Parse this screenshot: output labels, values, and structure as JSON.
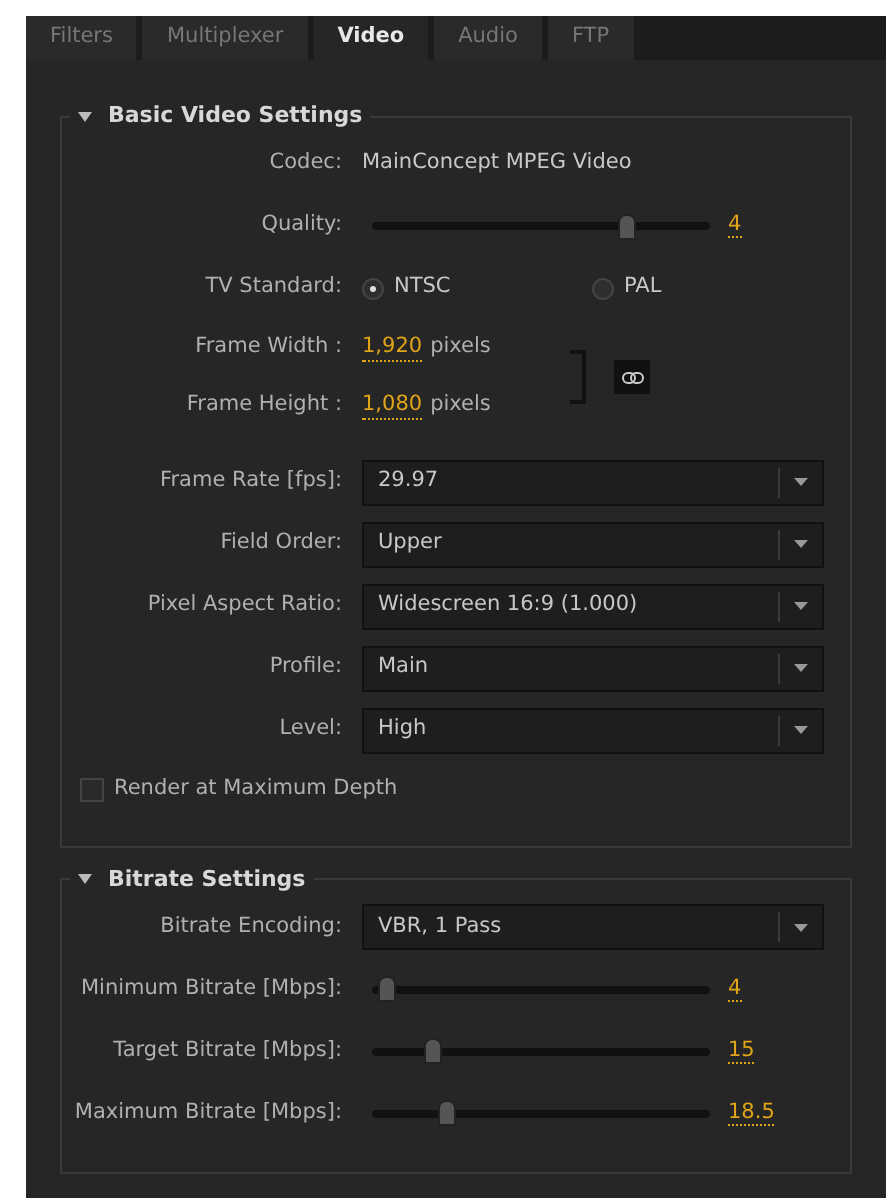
{
  "tabs": [
    {
      "label": "Filters",
      "selected": false
    },
    {
      "label": "Multiplexer",
      "selected": false
    },
    {
      "label": "Video",
      "selected": true
    },
    {
      "label": "Audio",
      "selected": false
    },
    {
      "label": "FTP",
      "selected": false
    }
  ],
  "sections": [
    {
      "title": "Basic Video Settings",
      "expanded": true,
      "rows": [
        {
          "kind": "text",
          "label": "Codec:",
          "value": "MainConcept MPEG Video"
        },
        {
          "kind": "slider",
          "label": "Quality:",
          "level": 0.75,
          "value": "4"
        },
        {
          "kind": "radio",
          "label": "TV Standard:",
          "options": [
            {
              "label": "NTSC",
              "selected": true
            },
            {
              "label": "PAL",
              "selected": false
            }
          ]
        },
        {
          "kind": "dimensions",
          "linked": true,
          "fields": [
            {
              "label": "Frame Width :",
              "value": "1,920",
              "unit": "pixels"
            },
            {
              "label": "Frame Height :",
              "value": "1,080",
              "unit": "pixels"
            }
          ]
        },
        {
          "kind": "dropdown",
          "label": "Frame Rate [fps]:",
          "value": "29.97"
        },
        {
          "kind": "dropdown",
          "label": "Field Order:",
          "value": "Upper"
        },
        {
          "kind": "dropdown",
          "label": "Pixel Aspect Ratio:",
          "value": "Widescreen 16:9 (1.000)"
        },
        {
          "kind": "dropdown",
          "label": "Profile:",
          "value": "Main"
        },
        {
          "kind": "dropdown",
          "label": "Level:",
          "value": "High"
        },
        {
          "kind": "checkbox",
          "label": "Render at Maximum Depth",
          "checked": false
        }
      ]
    },
    {
      "title": "Bitrate Settings",
      "expanded": true,
      "rows": [
        {
          "kind": "dropdown",
          "label": "Bitrate Encoding:",
          "value": "VBR, 1 Pass"
        },
        {
          "kind": "slider",
          "label": "Minimum Bitrate [Mbps]:",
          "level": 0.04,
          "value": "4"
        },
        {
          "kind": "slider",
          "label": "Target Bitrate [Mbps]:",
          "level": 0.18,
          "value": "15"
        },
        {
          "kind": "slider",
          "label": "Maximum Bitrate [Mbps]:",
          "level": 0.22,
          "value": "18.5"
        }
      ]
    }
  ]
}
